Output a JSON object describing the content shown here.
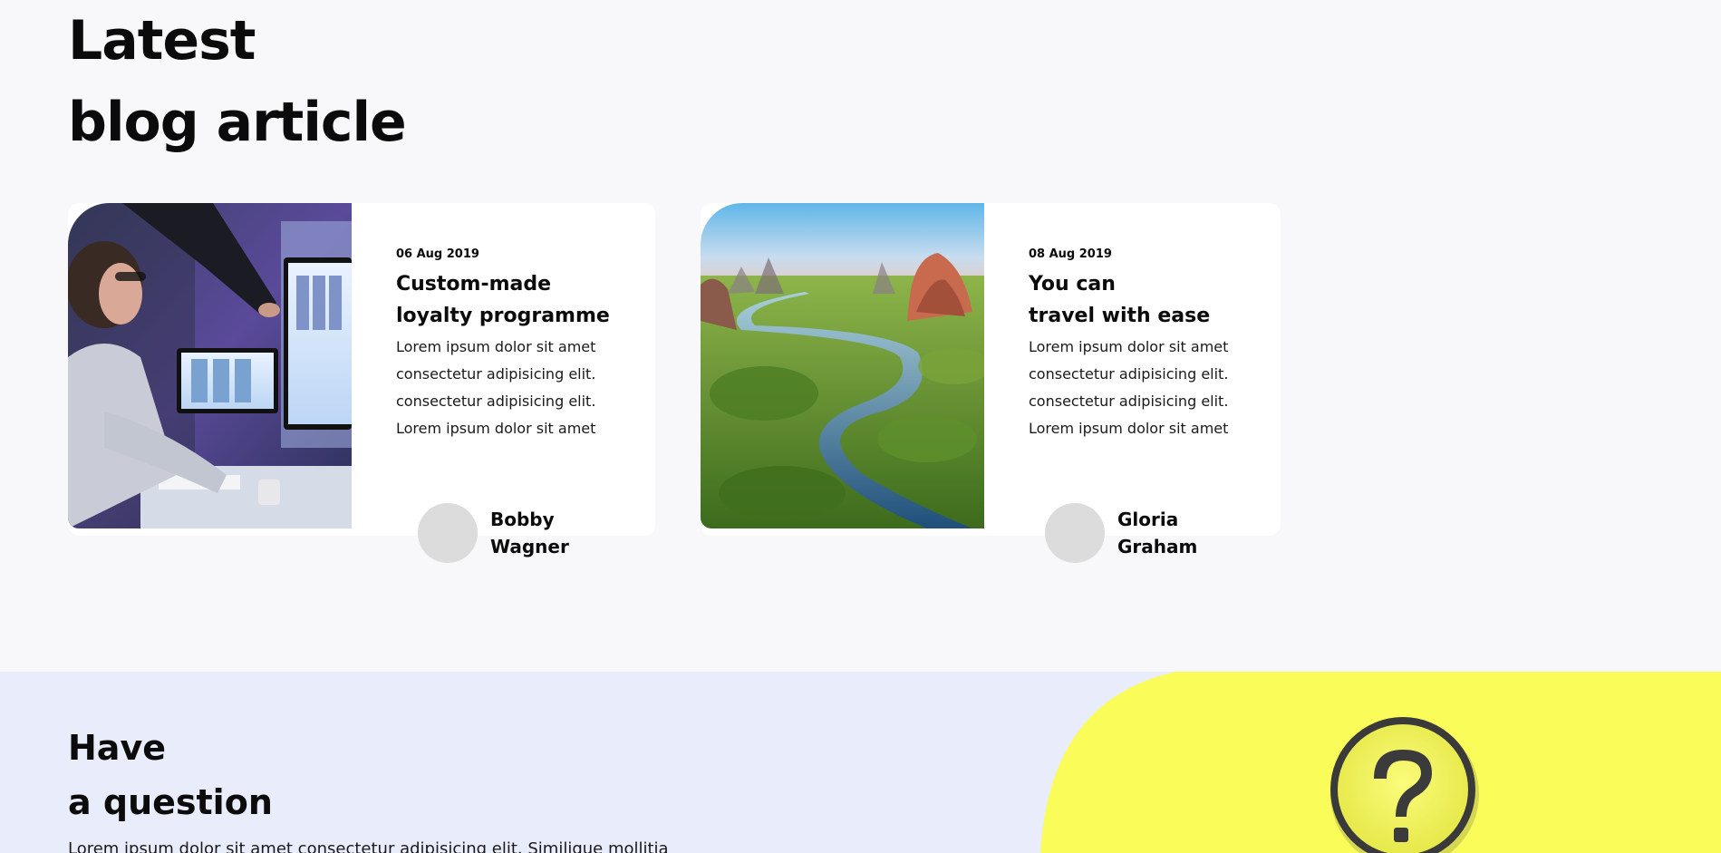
{
  "blog": {
    "title": "Latest\nblog article",
    "articles": [
      {
        "date": "06 Aug 2019",
        "title": "Custom-made\nloyalty programme",
        "excerpt": "Lorem ipsum dolor sit amet\nconsectetur adipisicing elit.\nconsectetur adipisicing elit.\nLorem ipsum dolor sit amet",
        "author": "Bobby\nWagner",
        "image": "woman-at-computer-photo"
      },
      {
        "date": "08 Aug 2019",
        "title": "You can\ntravel with ease",
        "excerpt": "Lorem ipsum dolor sit amet\nconsectetur adipisicing elit.\nconsectetur adipisicing elit.\nLorem ipsum dolor sit amet",
        "author": "Gloria\nGraham",
        "image": "river-landscape-photo"
      }
    ]
  },
  "question": {
    "title": "Have\na question",
    "text": "Lorem ipsum dolor sit amet consectetur adipisicing elit. Similique mollitia",
    "image": "magnifier-question-mark-photo",
    "colors": {
      "section_background": "#e9ecfb",
      "accent_yellow": "#fafc5a"
    }
  },
  "colors": {
    "page_background": "#f8f8fa",
    "card_background": "#ffffff",
    "avatar_placeholder": "#dcdcdc",
    "text": "#0b0b0b"
  }
}
